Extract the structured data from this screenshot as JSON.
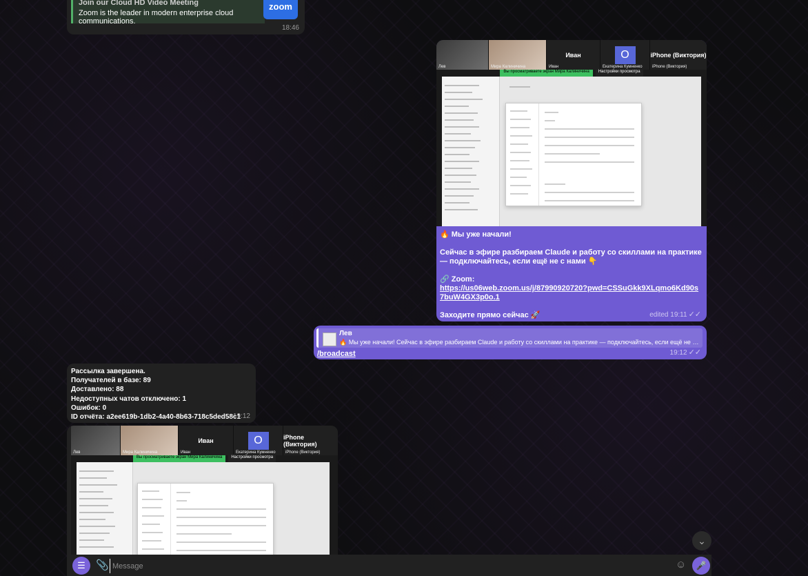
{
  "zoom_preview": {
    "title": "Join our Cloud HD Video Meeting",
    "description": "Zoom is the leader in modern enterprise cloud communications.",
    "logo_text": "zoom",
    "time": "18:46"
  },
  "meeting_tiles": [
    {
      "label": "",
      "name": "Лев"
    },
    {
      "label": "",
      "name": "Мира Калиничина"
    },
    {
      "label": "Иван",
      "name": "Иван"
    },
    {
      "label": "О",
      "name": "Екатерина Кумненко"
    },
    {
      "label": "iPhone (Виктория)",
      "name": "iPhone (Виктория)"
    }
  ],
  "share_bar": {
    "viewing": "Вы просматриваете экран Мира Калиничина",
    "settings": "Настройки просмотра"
  },
  "screen_title": "Профиля",
  "broadcast_message": {
    "line1": "🔥 Мы уже начали!",
    "line2": "Сейчас в эфире разбираем Claude и работу со скиллами на практике — подключайтесь, если ещё не с нами 👇",
    "zoom_label": "🔗 Zoom:",
    "zoom_link": "https://us06web.zoom.us/j/87990920720?pwd=CSSuGkk9XLqmo6Kd90s7buW4GX3p0o.1",
    "line3": "Заходите прямо сейчас 🚀",
    "time": "edited 19:11"
  },
  "reply_message": {
    "author": "Лев",
    "quote": "🔥 Мы уже начали! Сейчас в эфире разбираем Claude и работу со скиллами на практике — подключайтесь, если ещё не с нами…",
    "command": "/broadcast",
    "time": "19:12"
  },
  "report_message": {
    "lines": [
      "Рассылка завершена.",
      "Получателей в базе: 89",
      "Доставлено: 88",
      "Недоступных чатов отключено: 1",
      "Ошибок: 0",
      "ID отчёта: a2ee619b-1db2-4a40-8b63-718c5ded58c1"
    ],
    "time": "19:12"
  },
  "composer": {
    "placeholder": "Message"
  },
  "colors": {
    "outgoing": "#6f5bd3",
    "incoming": "#212121",
    "accent": "#7a63da"
  }
}
